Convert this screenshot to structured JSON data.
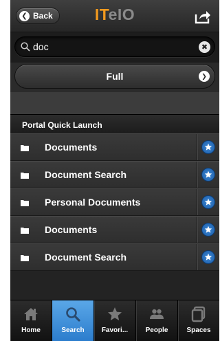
{
  "header": {
    "back_label": "Back",
    "logo_part1": "IT",
    "logo_part2": "eIO"
  },
  "search": {
    "value": "doc",
    "placeholder": ""
  },
  "filter": {
    "selected": "Full"
  },
  "list": {
    "header": "Portal Quick Launch",
    "items": [
      {
        "label": "Documents"
      },
      {
        "label": "Document Search"
      },
      {
        "label": "Personal Documents"
      },
      {
        "label": "Documents"
      },
      {
        "label": "Document Search"
      }
    ]
  },
  "tabs": [
    {
      "label": "Home",
      "icon": "home-icon"
    },
    {
      "label": "Search",
      "icon": "search-icon",
      "active": true
    },
    {
      "label": "Favori...",
      "icon": "star-icon"
    },
    {
      "label": "People",
      "icon": "people-icon"
    },
    {
      "label": "Spaces",
      "icon": "spaces-icon"
    }
  ],
  "colors": {
    "logo_accent": "#f39a1e",
    "logo_secondary": "#8a8a8a",
    "active_tab": "#3f8fdb",
    "star_button": "#2a72c2"
  }
}
